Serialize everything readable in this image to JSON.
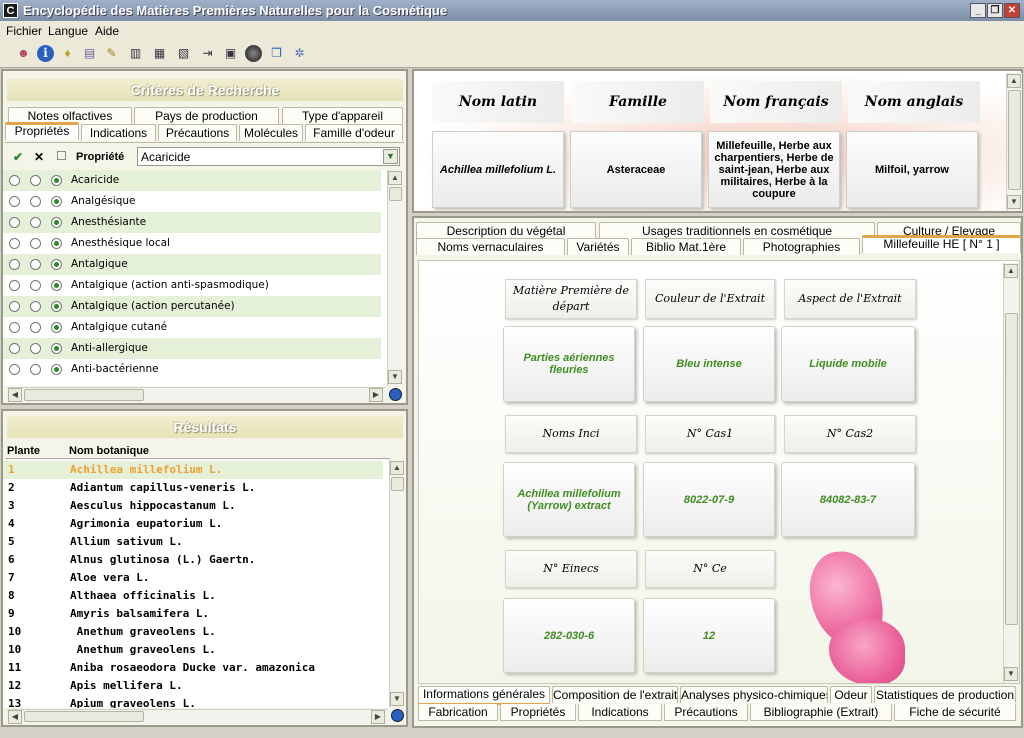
{
  "window": {
    "title": "Encyclopédie des Matières Premières Naturelles pour la Cosmétique",
    "app_icon": "C"
  },
  "menu": [
    "Fichier",
    "Langue",
    "Aide"
  ],
  "toolbar_icons": [
    "users-icon",
    "info-icon",
    "bulb-icon",
    "cards-icon",
    "note-icon",
    "form-icon",
    "list-icon",
    "import-icon",
    "window-icon",
    "globe-icon",
    "book-icon",
    "gear-icon"
  ],
  "search": {
    "header": "Critères de Recherche",
    "tabs_row1": [
      "Notes olfactives",
      "Pays de production",
      "Type d'appareil"
    ],
    "tabs_row2": [
      "Propriétés",
      "Indications",
      "Précautions",
      "Molécules",
      "Famille d'odeur"
    ],
    "column_label": "Propriété",
    "selected_property": "Acaricide",
    "check_symbol": "✔",
    "cross_symbol": "✕",
    "box_symbol": "☐",
    "properties": [
      "Acaricide",
      "Analgésique",
      "Anesthésiante",
      "Anesthésique local",
      "Antalgique",
      "Antalgique (action anti-spasmodique)",
      "Antalgique (action percutanée)",
      "Antalgique cutané",
      "Anti-allergique",
      "Anti-bactérienne"
    ]
  },
  "results": {
    "header": "Résultats",
    "col_plant": "Plante",
    "col_name": "Nom botanique",
    "rows": [
      {
        "n": "1",
        "name": "Achillea millefolium L."
      },
      {
        "n": "2",
        "name": "Adiantum capillus-veneris L."
      },
      {
        "n": "3",
        "name": "Aesculus hippocastanum L."
      },
      {
        "n": "4",
        "name": "Agrimonia eupatorium L."
      },
      {
        "n": "5",
        "name": "Allium sativum L."
      },
      {
        "n": "6",
        "name": "Alnus glutinosa (L.) Gaertn."
      },
      {
        "n": "7",
        "name": "Aloe vera L."
      },
      {
        "n": "8",
        "name": "Althaea officinalis L."
      },
      {
        "n": "9",
        "name": "Amyris balsamifera L."
      },
      {
        "n": "10",
        "name": " Anethum graveolens L."
      },
      {
        "n": "10",
        "name": " Anethum graveolens L."
      },
      {
        "n": "11",
        "name": "Aniba rosaeodora Ducke var. amazonica"
      },
      {
        "n": "12",
        "name": "Apis mellifera L."
      },
      {
        "n": "13",
        "name": "Apium graveolens L."
      }
    ]
  },
  "names": {
    "latin_label": "Nom latin",
    "latin": "Achillea millefolium L.",
    "family_label": "Famille",
    "family": "Asteraceae",
    "french_label": "Nom français",
    "french": "Millefeuille, Herbe aux charpentiers, Herbe de saint-jean, Herbe aux militaires, Herbe à la coupure",
    "english_label": "Nom anglais",
    "english": "Milfoil, yarrow"
  },
  "detail_tabs_row1": [
    "Description du végétal",
    "Usages traditionnels en cosmétique",
    "Culture / Elevage"
  ],
  "detail_tabs_row2": [
    "Noms vernaculaires",
    "Variétés",
    "Biblio Mat.1ère",
    "Photographies",
    "Millefeuille HE [ N° 1 ]"
  ],
  "extract": {
    "mp_label": "Matière Première de départ",
    "mp": "Parties aériennes fleuries",
    "color_label": "Couleur de l'Extrait",
    "color": "Bleu intense",
    "aspect_label": "Aspect de l'Extrait",
    "aspect": "Liquide mobile",
    "inci_label": "Noms Inci",
    "inci": "Achillea millefolium (Yarrow) extract",
    "cas1_label": "N° Cas1",
    "cas1": "8022-07-9",
    "cas2_label": "N° Cas2",
    "cas2": "84082-83-7",
    "einecs_label": "N° Einecs",
    "einecs": "282-030-6",
    "ce_label": "N° Ce",
    "ce": "12"
  },
  "bottom_tabs_row1": [
    "Informations générales",
    "Composition de l'extrait",
    "Analyses physico-chimiques",
    "Odeur",
    "Statistiques de production"
  ],
  "bottom_tabs_row2": [
    "Fabrication",
    "Propriétés",
    "Indications",
    "Précautions",
    "Bibliographie (Extrait)",
    "Fiche de sécurité"
  ],
  "colors": {
    "accent_orange": "#e7a34a",
    "value_green": "#3f8e22",
    "highlight_row": "#e5f0d8",
    "highlight_text": "#f0a030"
  }
}
